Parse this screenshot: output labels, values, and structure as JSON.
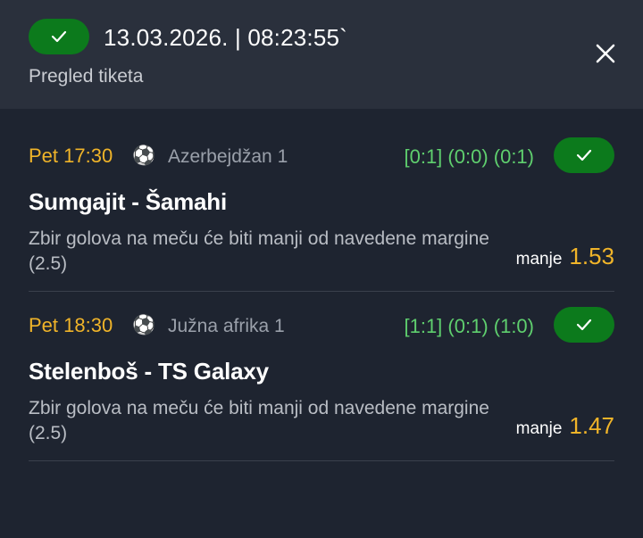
{
  "header": {
    "datetime": "13.03.2026. | 08:23:55`",
    "subtitle": "Pregled tiketa"
  },
  "colors": {
    "accent_green": "#0c7a1c",
    "odds_yellow": "#f0b429",
    "result_green": "#5fcf6e"
  },
  "tickets": [
    {
      "time": "Pet 17:30",
      "league": "Azerbejdžan 1",
      "result": "[0:1] (0:0) (0:1)",
      "match": "Sumgajit - Šamahi",
      "description": "Zbir golova na meču će biti manji od navedene margine (2.5)",
      "odds_label": "manje",
      "odds_value": "1.53"
    },
    {
      "time": "Pet 18:30",
      "league": "Južna afrika 1",
      "result": "[1:1] (0:1) (1:0)",
      "match": "Stelenboš - TS Galaxy",
      "description": "Zbir golova na meču će biti manji od navedene margine (2.5)",
      "odds_label": "manje",
      "odds_value": "1.47"
    }
  ]
}
